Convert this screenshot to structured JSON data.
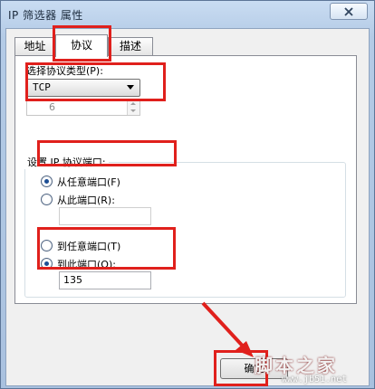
{
  "window": {
    "title": "IP 筛选器 属性"
  },
  "tabs": [
    {
      "label": "地址"
    },
    {
      "label": "协议"
    },
    {
      "label": "描述"
    }
  ],
  "protocol": {
    "type_label": "选择协议类型(P):",
    "type_value": "TCP",
    "number_value": "6"
  },
  "port_group": {
    "title": "设置 IP 协议端口:",
    "from_any": "从任意端口(F)",
    "from_this": "从此端口(R):",
    "from_this_value": "",
    "to_any": "到任意端口(T)",
    "to_this": "到此端口(O):",
    "to_this_value": "135"
  },
  "footer": {
    "ok_label": "确定"
  },
  "watermark": {
    "brand": "脚本之家",
    "url": "www.jb51.net"
  },
  "colors": {
    "highlight": "#e0201c",
    "selected_radio": "#1d4f95"
  }
}
